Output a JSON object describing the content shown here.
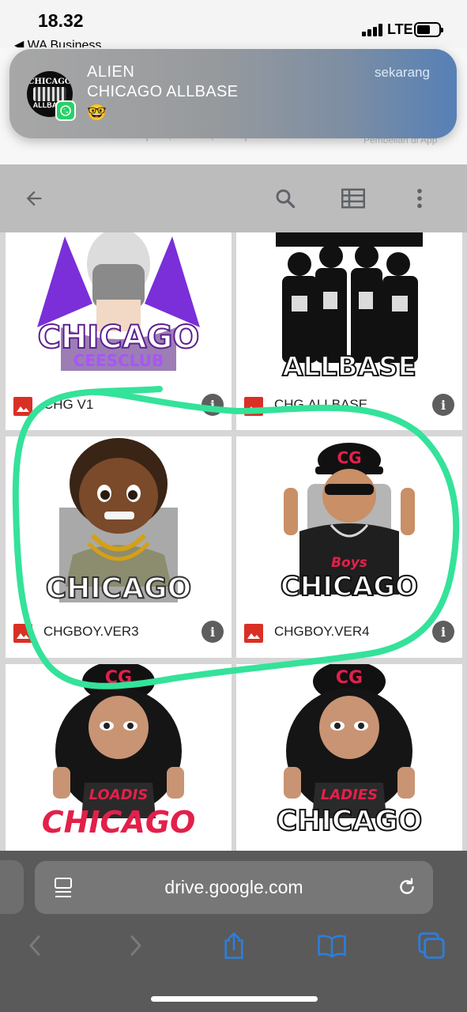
{
  "status_bar": {
    "time": "18.32",
    "back_app": "◀ WA Business",
    "network": "LTE"
  },
  "background_page": {
    "text": "Simpan, akses, dan pindai file",
    "right_text": "Pembelian di App"
  },
  "notification": {
    "title": "ALIEN",
    "subtitle": "CHICAGO ALLBASE",
    "message": "🤓",
    "time": "sekarang",
    "avatar_text_top": "CHICAGO",
    "avatar_text_bottom": "ALLBASE"
  },
  "toolbar": {
    "icons": [
      "back-arrow-icon",
      "search-icon",
      "list-view-icon",
      "more-vert-icon"
    ]
  },
  "files": [
    {
      "name": "CHG V1",
      "art_text": "CHICAGO",
      "art_sub": "CEESCLUB",
      "art_color": "#5b1f8f"
    },
    {
      "name": "CHG.ALLBASE",
      "art_text": "CHICAGO",
      "art_sub": "ALLBASE",
      "art_color": "#111111"
    },
    {
      "name": "CHGBOY.VER3",
      "art_text": "CHICAGO",
      "art_color": "#333333"
    },
    {
      "name": "CHGBOY.VER4",
      "art_text": "CHICAGO",
      "art_sub": "Boys",
      "art_color": "#111111"
    },
    {
      "name": "",
      "art_text": "CHICAGO",
      "art_sub": "LOADIS",
      "art_color": "#e3204a"
    },
    {
      "name": "",
      "art_text": "CHICAGO",
      "art_sub": "LADIES",
      "art_color": "#111111"
    }
  ],
  "browser": {
    "url": "drive.google.com"
  },
  "colors": {
    "highlight_stroke": "#34e29a",
    "image_icon": "#d93025",
    "notification_accent": "#5680b6"
  }
}
